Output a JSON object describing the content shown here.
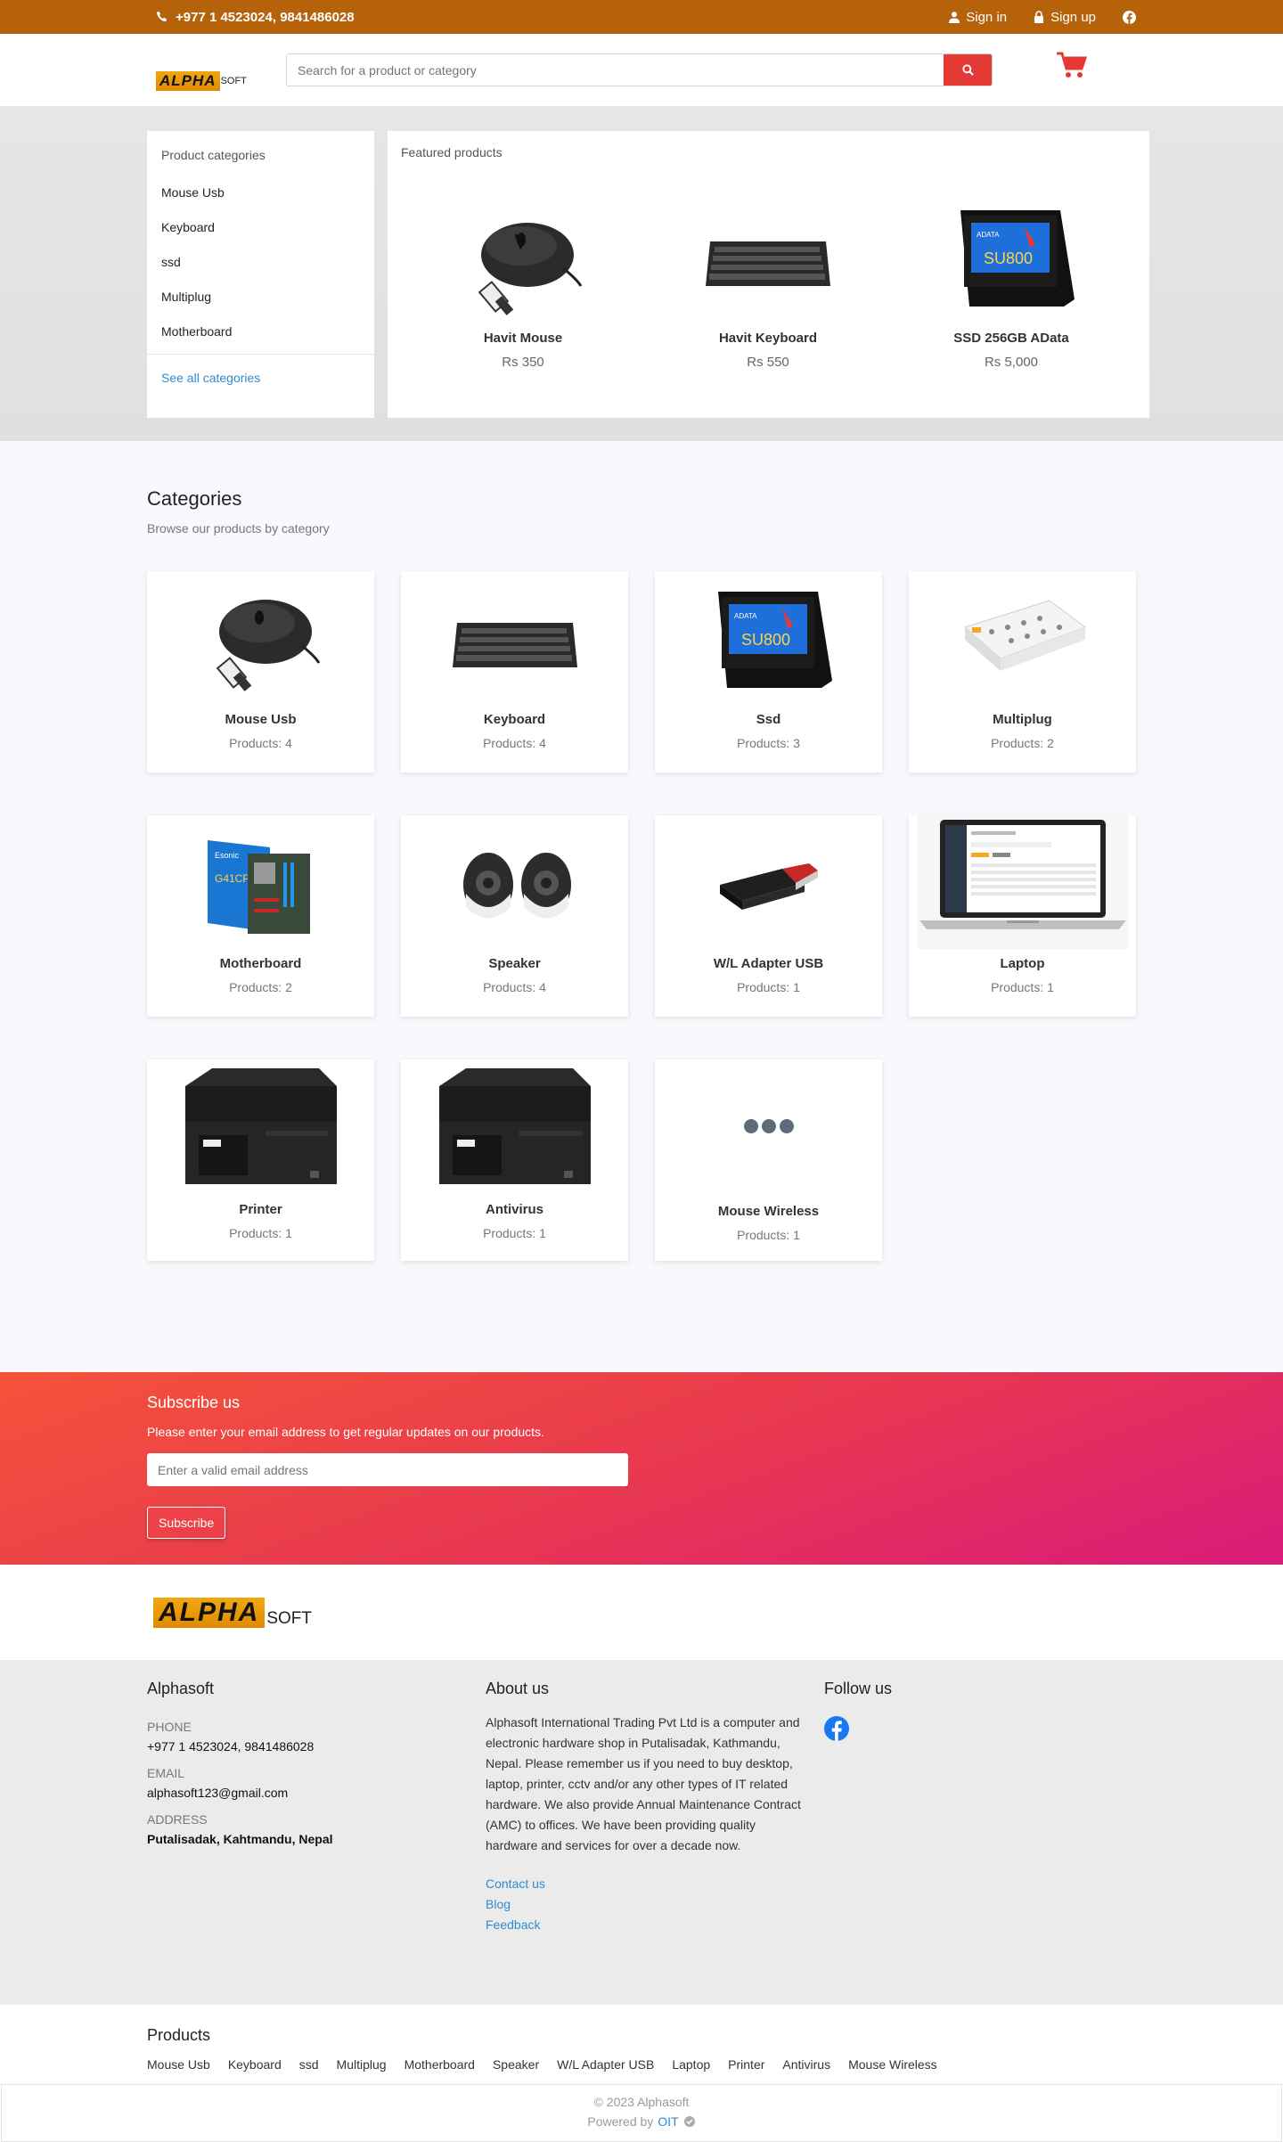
{
  "topbar": {
    "phone": "+977 1 4523024, 9841486028",
    "sign_in": "Sign in",
    "sign_up": "Sign up"
  },
  "header": {
    "logo_mark": "ALPHA",
    "logo_word": "SOFT",
    "search_placeholder": "Search for a product or category"
  },
  "sidebar": {
    "title": "Product categories",
    "items": [
      "Mouse Usb",
      "Keyboard",
      "ssd",
      "Multiplug",
      "Motherboard"
    ],
    "see_all": "See all categories"
  },
  "featured": {
    "title": "Featured products",
    "products": [
      {
        "name": "Havit Mouse",
        "price": "Rs 350",
        "icon": "mouse"
      },
      {
        "name": "Havit Keyboard",
        "price": "Rs 550",
        "icon": "keyboard"
      },
      {
        "name": "SSD 256GB AData",
        "price": "Rs 5,000",
        "icon": "ssd"
      }
    ]
  },
  "categories": {
    "title": "Categories",
    "subtitle": "Browse our products by category",
    "items": [
      {
        "name": "Mouse Usb",
        "count": "Products: 4",
        "icon": "mouse"
      },
      {
        "name": "Keyboard",
        "count": "Products: 4",
        "icon": "keyboard"
      },
      {
        "name": "Ssd",
        "count": "Products: 3",
        "icon": "ssd"
      },
      {
        "name": "Multiplug",
        "count": "Products: 2",
        "icon": "multiplug"
      },
      {
        "name": "Motherboard",
        "count": "Products: 2",
        "icon": "motherboard"
      },
      {
        "name": "Speaker",
        "count": "Products: 4",
        "icon": "speaker"
      },
      {
        "name": "W/L Adapter USB",
        "count": "Products: 1",
        "icon": "usb-adapter"
      },
      {
        "name": "Laptop",
        "count": "Products: 1",
        "icon": "laptop"
      },
      {
        "name": "Printer",
        "count": "Products: 1",
        "icon": "printer"
      },
      {
        "name": "Antivirus",
        "count": "Products: 1",
        "icon": "printer"
      },
      {
        "name": "Mouse Wireless",
        "count": "Products: 1",
        "icon": "more-dots"
      }
    ]
  },
  "subscribe": {
    "title": "Subscribe us",
    "text": "Please enter your email address to get regular updates on our products.",
    "placeholder": "Enter a valid email address",
    "button": "Subscribe"
  },
  "footer": {
    "company": {
      "title": "Alphasoft",
      "phone_label": "PHONE",
      "phone": "+977 1 4523024, 9841486028",
      "email_label": "EMAIL",
      "email": "alphasoft123@gmail.com",
      "address_label": "ADDRESS",
      "address": "Putalisadak, Kahtmandu, Nepal"
    },
    "about": {
      "title": "About us",
      "text": "Alphasoft International Trading Pvt Ltd is a computer and electronic hardware shop in Putalisadak, Kathmandu, Nepal. Please remember us if you need to buy desktop, laptop, printer, cctv and/or any other types of IT related hardware. We also provide Annual Maintenance Contract (AMC) to offices. We have been providing quality hardware and services for over a decade now.",
      "links": [
        "Contact us",
        "Blog",
        "Feedback"
      ]
    },
    "follow": {
      "title": "Follow us"
    },
    "products": {
      "title": "Products",
      "items": [
        "Mouse Usb",
        "Keyboard",
        "ssd",
        "Multiplug",
        "Motherboard",
        "Speaker",
        "W/L Adapter USB",
        "Laptop",
        "Printer",
        "Antivirus",
        "Mouse Wireless"
      ]
    },
    "copyright": "© 2023 Alphasoft",
    "powered_by": "Powered by",
    "powered_name": "OIT"
  },
  "colors": {
    "topbar": "#b5620a",
    "accent_red": "#e53935",
    "link_blue": "#2f8bd0"
  }
}
